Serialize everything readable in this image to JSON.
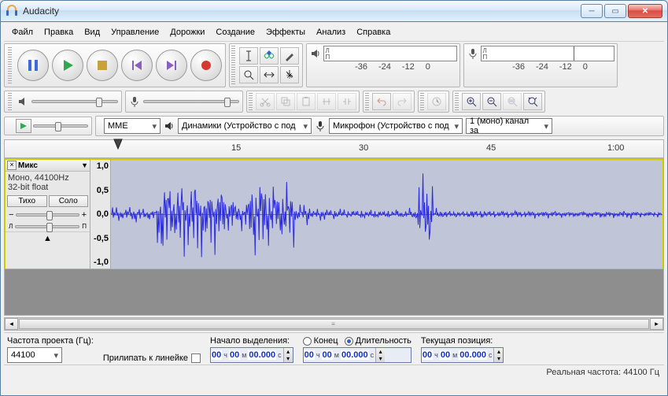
{
  "window": {
    "title": "Audacity"
  },
  "menu": {
    "file": "Файл",
    "edit": "Правка",
    "view": "Вид",
    "transport": "Управление",
    "tracks": "Дорожки",
    "generate": "Создание",
    "effect": "Эффекты",
    "analyze": "Анализ",
    "help": "Справка"
  },
  "meter": {
    "ticks": [
      "-36",
      "-24",
      "-12",
      "0"
    ]
  },
  "devices": {
    "host": "MME",
    "output": "Динамики (Устройство с под",
    "input": "Микрофон (Устройство с под",
    "channels": "1 (моно) канал за"
  },
  "ruler": {
    "t15": "15",
    "t30": "30",
    "t45": "45",
    "t60": "1:00"
  },
  "track": {
    "name": "Микс",
    "meta1": "Моно, 44100Hz",
    "meta2": "32-bit float",
    "mute": "Тихо",
    "solo": "Соло",
    "amp": {
      "p10": "1,0",
      "p05": "0,5",
      "z": "0,0",
      "n05": "-0,5",
      "n10": "-1,0"
    }
  },
  "selection": {
    "rate_label": "Частота проекта (Гц):",
    "rate_value": "44100",
    "snap_label": "Прилипать к линейке",
    "start_label": "Начало выделения:",
    "end_label": "Конец",
    "length_label": "Длительность",
    "pos_label": "Текущая позиция:",
    "time": {
      "h": "00",
      "hl": "ч",
      "m": "00",
      "ml": "м",
      "s": "00.000",
      "sl": "с"
    }
  },
  "status": {
    "text": "Реальная частота: 44100 Гц"
  },
  "icons": {
    "pause": "pause",
    "play": "play",
    "stop": "stop",
    "skip_start": "skip-start",
    "skip_end": "skip-end",
    "record": "record",
    "ibeam": "ibeam",
    "envelope": "envelope",
    "draw": "pencil",
    "zoom": "zoom",
    "timeshift": "timeshift",
    "multi": "multi",
    "speaker": "speaker",
    "mic": "mic",
    "cut": "cut",
    "copy": "copy",
    "paste": "paste",
    "trim": "trim",
    "silence": "silence",
    "undo": "undo",
    "redo": "redo",
    "sync": "sync",
    "zoomin": "zoomin",
    "zoomout": "zoomout",
    "zoomsel": "zoomsel",
    "zoomfit": "zoomfit"
  }
}
